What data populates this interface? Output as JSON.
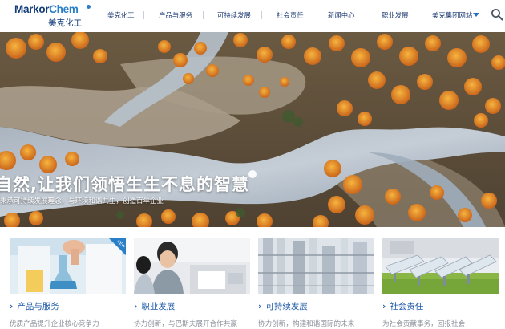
{
  "header": {
    "logo_en_part1": "Markor",
    "logo_en_part2": "Chem",
    "logo_cn": "美克化工",
    "nav": [
      "美克化工",
      "产品与服务",
      "可持续发展",
      "社会责任",
      "新闻中心",
      "职业发展"
    ],
    "group_site": "美克集团网站"
  },
  "hero": {
    "headline": "自然,让我们领悟生生不息的智慧",
    "subline": "秉承可持续发展理念，与环境和谐共生，创造百年企业"
  },
  "cards": [
    {
      "title": "产品与服务",
      "desc": "优质产品提升企业核心竞争力",
      "badge": "NEW"
    },
    {
      "title": "职业发展",
      "desc": "协力创新，与巴斯夫展开合作共赢",
      "badge": ""
    },
    {
      "title": "可持续发展",
      "desc": "协力创新，构建和谐国际的未来",
      "badge": ""
    },
    {
      "title": "社会责任",
      "desc": "为社会贡献事务，回报社会",
      "badge": ""
    }
  ],
  "colors": {
    "brand_navy": "#123c7a",
    "brand_blue": "#2a80c8",
    "nav_text": "#1f3c73",
    "card_title": "#1e5aa8"
  }
}
